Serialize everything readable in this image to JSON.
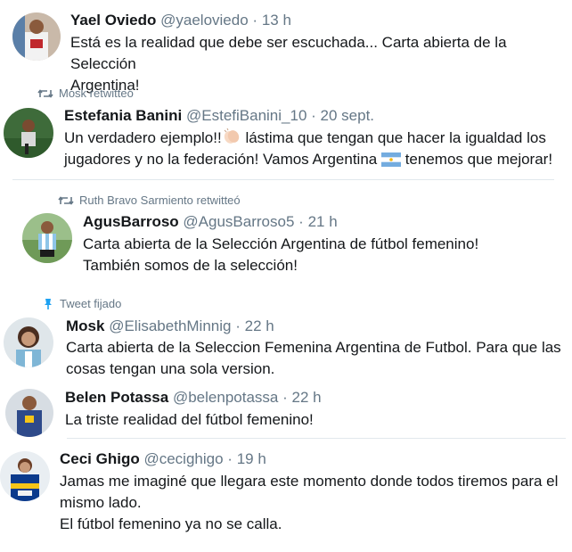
{
  "tweets": [
    {
      "name": "Yael Oviedo",
      "handle": "@yaeloviedo",
      "sep": "·",
      "time": "13 h",
      "lines": [
        "Está es la realidad que debe ser escuchada... Carta abierta de la Selección",
        "Argentina!"
      ]
    },
    {
      "social": "Mosk retwitteó",
      "name": "Estefania Banini",
      "handle": "@EstefiBanini_10",
      "sep": "·",
      "time": "20 sept.",
      "line1_a": "Un verdadero ejemplo!!",
      "line1_b": " lástima que tengan que hacer la igualdad los",
      "line2_a": "jugadores y no la federación! Vamos Argentina ",
      "line2_b": " tenemos que mejorar!"
    },
    {
      "social": "Ruth Bravo Sarmiento retwitteó",
      "name": "AgusBarroso",
      "handle": "@AgusBarroso5",
      "sep": "·",
      "time": "21 h",
      "lines": [
        "Carta abierta de la Selección Argentina de fútbol femenino!",
        "También somos de la selección!"
      ]
    },
    {
      "social": "Tweet fijado",
      "name": "Mosk",
      "handle": "@ElisabethMinnig",
      "sep": "·",
      "time": "22 h",
      "lines": [
        "Carta abierta de la Seleccion Femenina Argentina de Futbol. Para que las",
        "cosas tengan una sola version."
      ]
    },
    {
      "name": "Belen Potassa",
      "handle": "@belenpotassa",
      "sep": "·",
      "time": "22 h",
      "lines": [
        "La triste realidad del fútbol femenino!"
      ]
    },
    {
      "name": "Ceci Ghigo",
      "handle": "@cecighigo",
      "sep": "·",
      "time": "19 h",
      "lines": [
        "Jamas me imaginé que llegara este momento donde todos tiremos para el",
        "mismo lado.",
        "El fútbol femenino ya no se calla."
      ]
    }
  ],
  "icons": {
    "retweet": "retweet-icon",
    "pin": "pin-icon",
    "clap": "clapping-hands-emoji",
    "flag": "argentina-flag-emoji"
  },
  "colors": {
    "text": "#14171a",
    "secondary": "#657786",
    "pin_blue": "#1da1f2",
    "divider": "#e1e8ed"
  }
}
